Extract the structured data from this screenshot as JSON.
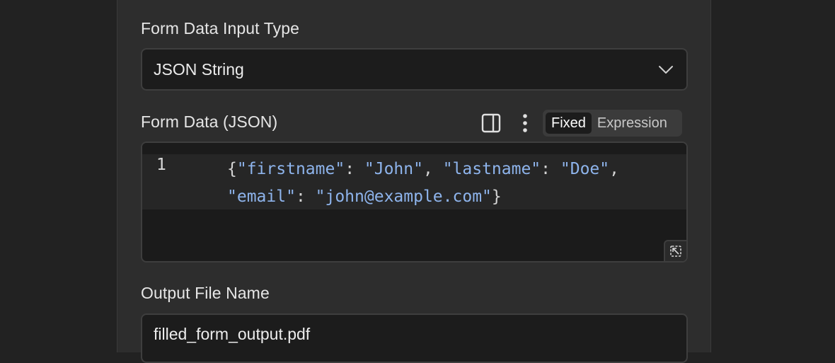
{
  "form_data_input_type": {
    "label": "Form Data Input Type",
    "selected": "JSON String",
    "chevron_icon": "chevron-down-icon"
  },
  "form_data": {
    "label": "Form Data (JSON)",
    "toolbar": {
      "panel_icon": "split-panel-icon",
      "more_icon": "more-vertical-icon",
      "mode_fixed": "Fixed",
      "mode_expression": "Expression",
      "active_mode": "Fixed"
    },
    "editor": {
      "line_number": "1",
      "tokens": {
        "open": "{",
        "k1": "\"firstname\"",
        "c1": ": ",
        "v1": "\"John\"",
        "s1": ", ",
        "k2": "\"lastname\"",
        "c2": ": ",
        "v2": "\"Doe\"",
        "s2": ",",
        "k3": "\"email\"",
        "c3": ": ",
        "v3": "\"john@example.com\"",
        "close": "}"
      },
      "resize_icon": "expand-icon"
    }
  },
  "output_file_name": {
    "label": "Output File Name",
    "value": "filled_form_output.pdf"
  },
  "colors": {
    "background": "#222222",
    "panel": "#2d2d2d",
    "json_token": "#8eb4ec"
  }
}
